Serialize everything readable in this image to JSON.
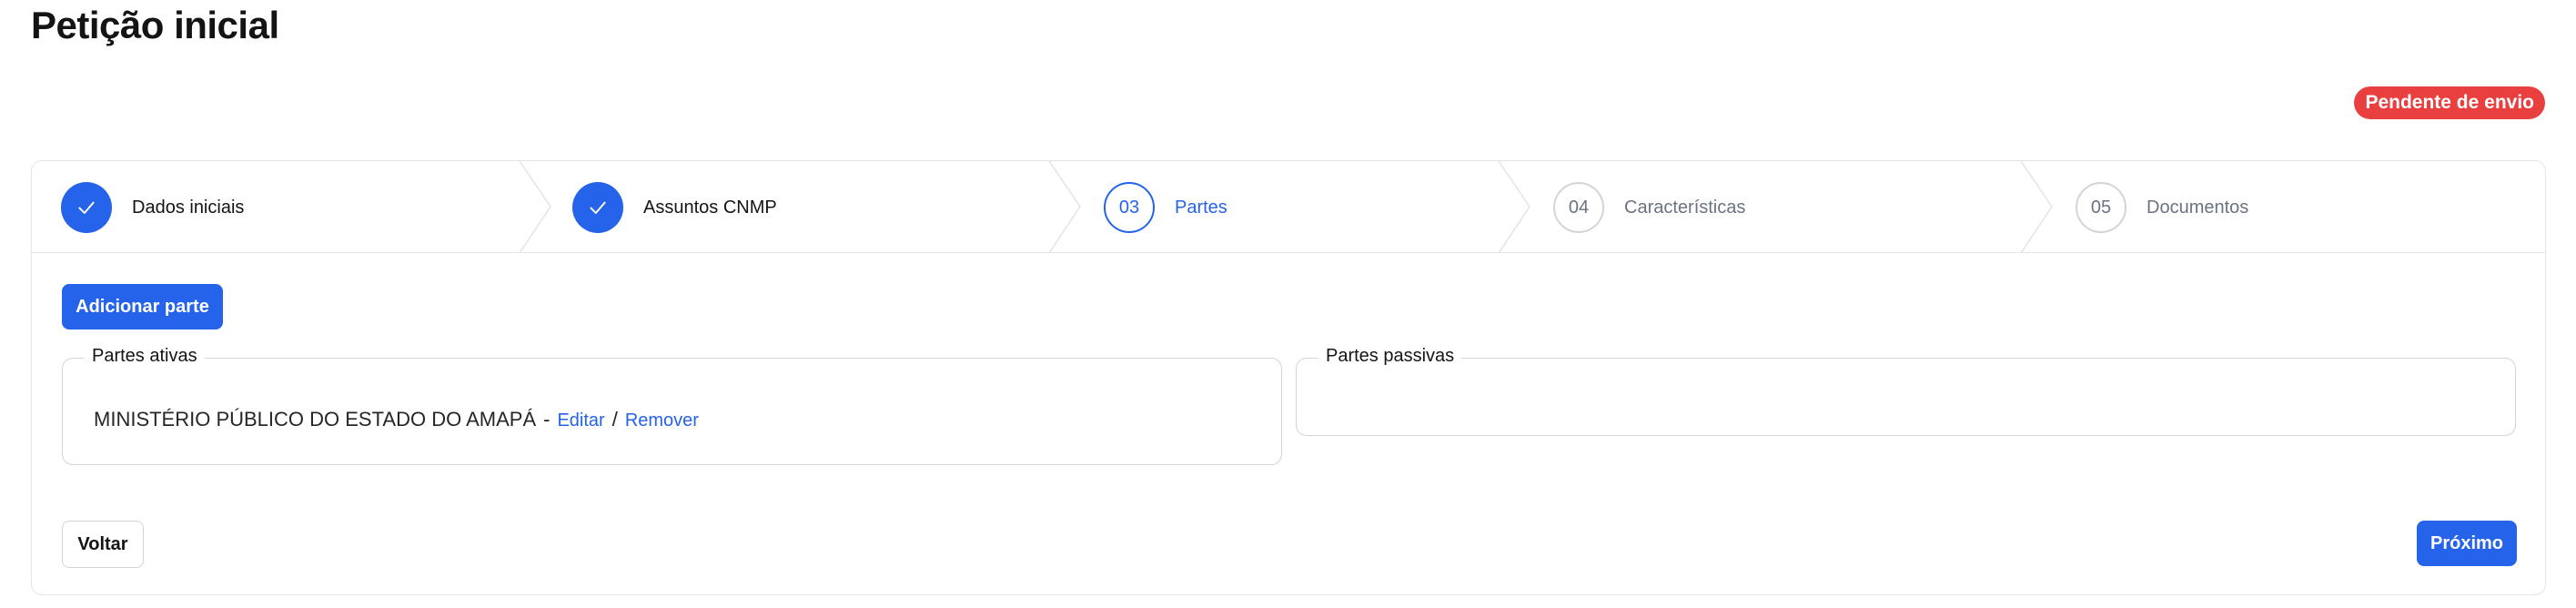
{
  "page": {
    "title": "Petição inicial",
    "status_badge": "Pendente de envio"
  },
  "colors": {
    "accent": "#2563eb",
    "status_pending": "#ea3f3f",
    "border": "#e4e4e7"
  },
  "stepper": {
    "steps": [
      {
        "number": "",
        "label": "Dados iniciais",
        "state": "done",
        "icon": "check-icon"
      },
      {
        "number": "",
        "label": "Assuntos CNMP",
        "state": "done",
        "icon": "check-icon"
      },
      {
        "number": "03",
        "label": "Partes",
        "state": "current"
      },
      {
        "number": "04",
        "label": "Características",
        "state": "upcoming"
      },
      {
        "number": "05",
        "label": "Documentos",
        "state": "upcoming"
      }
    ]
  },
  "actions": {
    "add_party": "Adicionar parte",
    "back": "Voltar",
    "next": "Próximo"
  },
  "active_parties": {
    "legend": "Partes ativas",
    "items": [
      {
        "name": "MINISTÉRIO PÚBLICO DO ESTADO DO AMAPÁ",
        "dash": "-",
        "edit": "Editar",
        "divider": "/",
        "remove": "Remover"
      }
    ]
  },
  "passive_parties": {
    "legend": "Partes passivas",
    "items": []
  }
}
